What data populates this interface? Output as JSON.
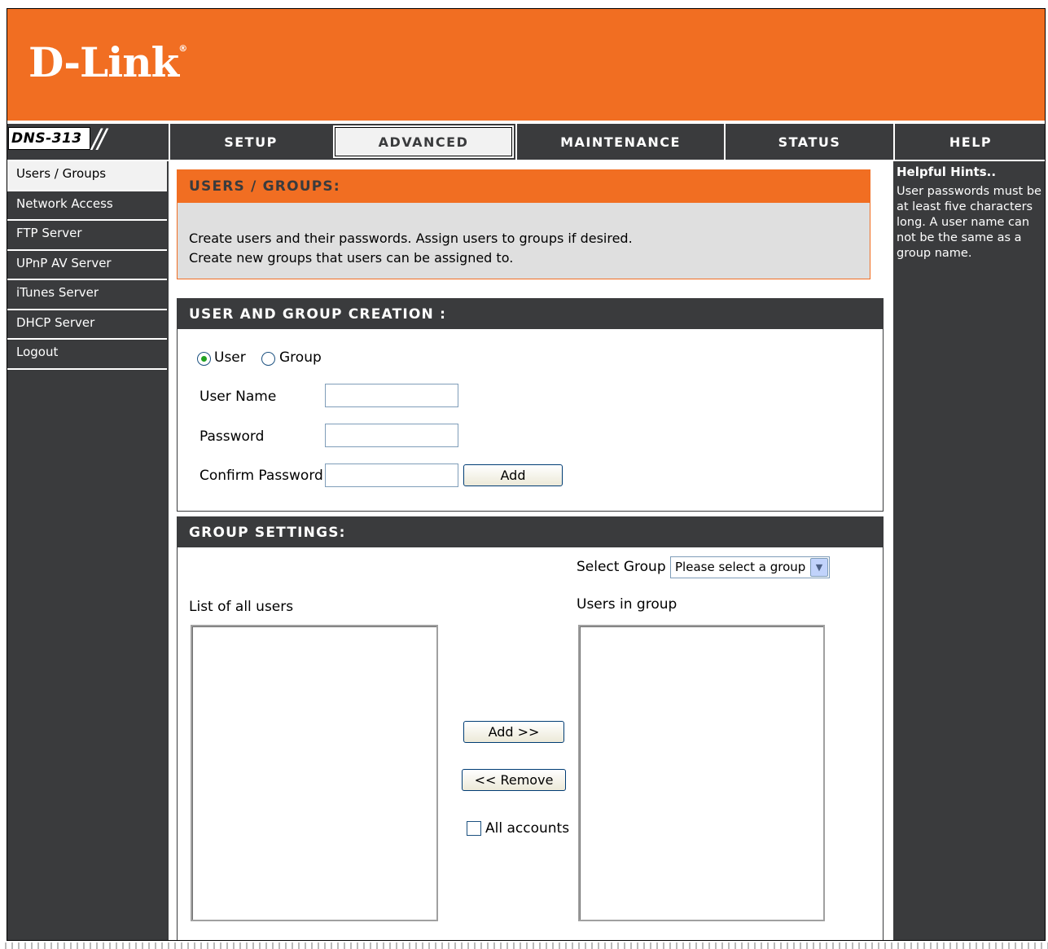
{
  "brand": {
    "name": "D-Link",
    "model": "DNS-313",
    "slashes": "//"
  },
  "tabs": [
    {
      "label": "SETUP"
    },
    {
      "label": "ADVANCED",
      "active": true
    },
    {
      "label": "MAINTENANCE"
    },
    {
      "label": "STATUS"
    },
    {
      "label": "HELP"
    }
  ],
  "sidebar": {
    "items": [
      {
        "label": "Users / Groups",
        "active": true
      },
      {
        "label": "Network Access"
      },
      {
        "label": "FTP Server"
      },
      {
        "label": "UPnP AV Server"
      },
      {
        "label": "iTunes Server"
      },
      {
        "label": "DHCP Server"
      },
      {
        "label": "Logout"
      }
    ]
  },
  "intro": {
    "title": "USERS / GROUPS:",
    "line1": "Create users and their passwords. Assign users to groups if desired.",
    "line2": "Create new groups that users can be assigned to."
  },
  "creation": {
    "title": "USER AND GROUP CREATION :",
    "radio_user": "User",
    "radio_group": "Group",
    "selected": "User",
    "username_label": "User Name",
    "password_label": "Password",
    "confirm_label": "Confirm Password",
    "username_value": "",
    "password_value": "",
    "confirm_value": "",
    "add_button": "Add"
  },
  "group_settings": {
    "title": "GROUP SETTINGS:",
    "select_group_label": "Select Group",
    "select_group_value": "Please select a group",
    "list_all_label": "List of all users",
    "users_in_group_label": "Users in group",
    "add_button": "Add >>",
    "remove_button": "<< Remove",
    "all_accounts_label": "All accounts",
    "all_accounts_checked": false
  },
  "help": {
    "title": "Helpful Hints..",
    "body": "User passwords must be at least five characters long. A user name can not be the same as a group name."
  },
  "colors": {
    "brand_orange": "#f16e22",
    "dark": "#3a3b3d",
    "panel_gray": "#dfdfdf"
  }
}
